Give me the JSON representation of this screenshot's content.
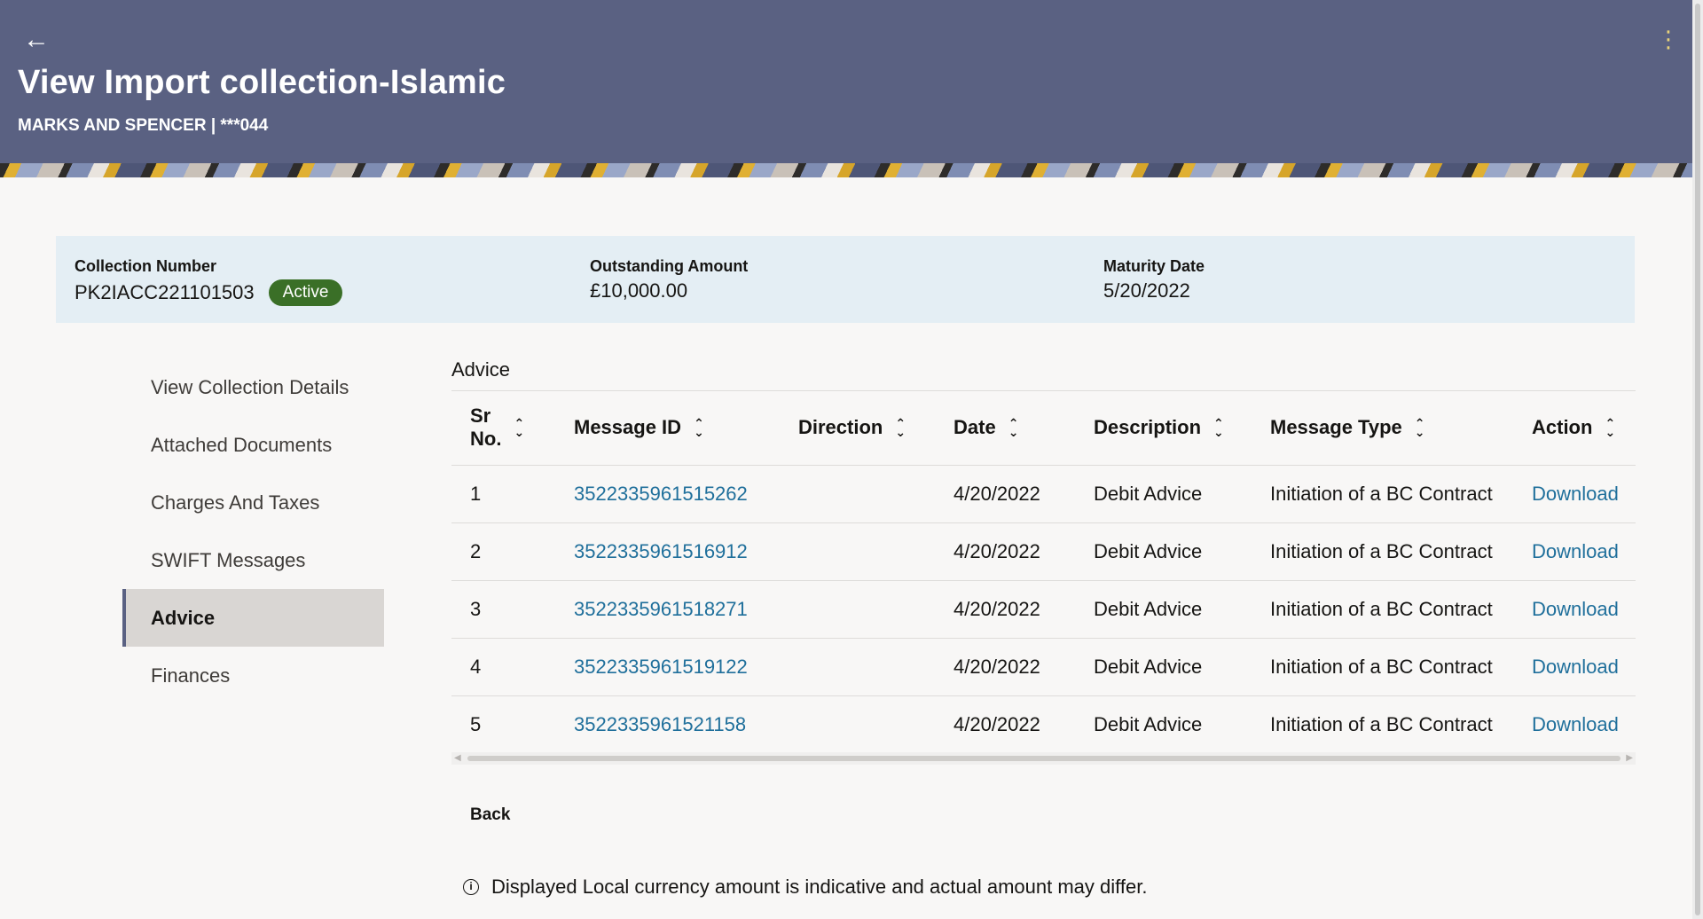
{
  "header": {
    "title": "View Import collection-Islamic",
    "subtitle": "MARKS AND SPENCER | ***044",
    "back_icon": "←",
    "more_icon": "⋮"
  },
  "summary": {
    "collection_number_label": "Collection Number",
    "collection_number": "PK2IACC221101503",
    "status": "Active",
    "outstanding_label": "Outstanding Amount",
    "outstanding_value": "£10,000.00",
    "maturity_label": "Maturity Date",
    "maturity_value": "5/20/2022"
  },
  "nav": {
    "items": [
      {
        "label": "View Collection Details"
      },
      {
        "label": "Attached Documents"
      },
      {
        "label": "Charges And Taxes"
      },
      {
        "label": "SWIFT Messages"
      },
      {
        "label": "Advice"
      },
      {
        "label": "Finances"
      }
    ]
  },
  "content": {
    "section_title": "Advice",
    "columns": {
      "sr_line1": "Sr",
      "sr_line2": "No.",
      "message_id": "Message ID",
      "direction": "Direction",
      "date": "Date",
      "description": "Description",
      "message_type": "Message Type",
      "action": "Action"
    },
    "rows": [
      {
        "sr": "1",
        "message_id": "3522335961515262",
        "direction": "",
        "date": "4/20/2022",
        "description": "Debit Advice",
        "message_type": "Initiation of a BC Contract",
        "action": "Download"
      },
      {
        "sr": "2",
        "message_id": "3522335961516912",
        "direction": "",
        "date": "4/20/2022",
        "description": "Debit Advice",
        "message_type": "Initiation of a BC Contract",
        "action": "Download"
      },
      {
        "sr": "3",
        "message_id": "3522335961518271",
        "direction": "",
        "date": "4/20/2022",
        "description": "Debit Advice",
        "message_type": "Initiation of a BC Contract",
        "action": "Download"
      },
      {
        "sr": "4",
        "message_id": "3522335961519122",
        "direction": "",
        "date": "4/20/2022",
        "description": "Debit Advice",
        "message_type": "Initiation of a BC Contract",
        "action": "Download"
      },
      {
        "sr": "5",
        "message_id": "3522335961521158",
        "direction": "",
        "date": "4/20/2022",
        "description": "Debit Advice",
        "message_type": "Initiation of a BC Contract",
        "action": "Download"
      }
    ],
    "back_label": "Back",
    "note": "Displayed Local currency amount is indicative and actual amount may differ."
  },
  "icons": {
    "sort": "sort-icon",
    "info": "info-icon"
  },
  "colors": {
    "header_bg": "#5a6182",
    "summary_bg": "#e4eef4",
    "active_badge": "#3a6f27",
    "link": "#1f6f9b"
  }
}
